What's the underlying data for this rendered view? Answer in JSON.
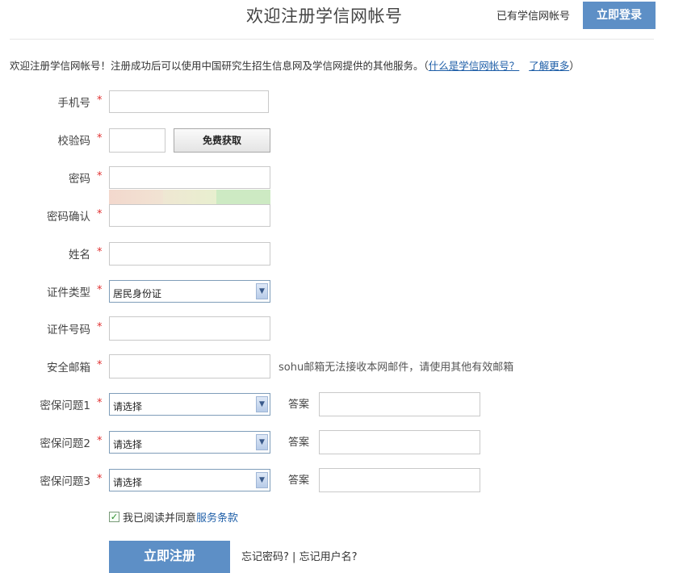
{
  "header": {
    "title": "欢迎注册学信网帐号",
    "have_account": "已有学信网帐号",
    "login_button": "立即登录"
  },
  "intro": {
    "text": "欢迎注册学信网帐号！注册成功后可以使用中国研究生招生信息网及学信网提供的其他服务。（",
    "link1": "什么是学信网帐号？",
    "link2": "了解更多",
    "close": "）"
  },
  "form": {
    "required_mark": "*",
    "phone_label": "手机号",
    "code_label": "校验码",
    "code_button": "免费获取",
    "password_label": "密码",
    "password_confirm_label": "密码确认",
    "name_label": "姓名",
    "id_type_label": "证件类型",
    "id_type_value": "居民身份证",
    "id_number_label": "证件号码",
    "email_label": "安全邮箱",
    "email_hint": "sohu邮箱无法接收本网邮件，请使用其他有效邮箱",
    "questions": [
      {
        "label": "密保问题1",
        "value": "请选择",
        "answer_label": "答案"
      },
      {
        "label": "密保问题2",
        "value": "请选择",
        "answer_label": "答案"
      },
      {
        "label": "密保问题3",
        "value": "请选择",
        "answer_label": "答案"
      }
    ],
    "agree_text": "我已阅读并同意",
    "agree_link": "服务条款",
    "agree_checked": true,
    "submit_button": "立即注册",
    "forgot_password": "忘记密码?",
    "forgot_sep": " | ",
    "forgot_username": "忘记用户名?"
  },
  "colors": {
    "accent": "#5d8fc6",
    "link": "#1f5fa8",
    "required": "#e03030",
    "strength_weak": "#f3ddd2",
    "strength_medium": "#efefcf",
    "strength_strong": "#ccebc2"
  }
}
